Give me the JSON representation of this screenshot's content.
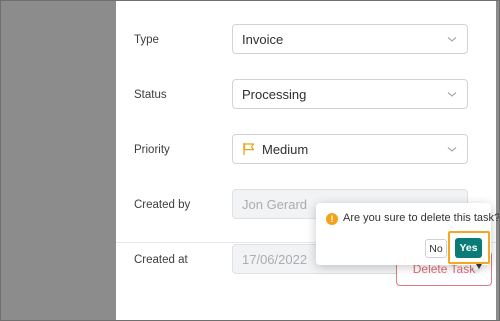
{
  "form": {
    "type": {
      "label": "Type",
      "value": "Invoice"
    },
    "status": {
      "label": "Status",
      "value": "Processing"
    },
    "priority": {
      "label": "Priority",
      "value": "Medium"
    },
    "created_by": {
      "label": "Created by",
      "value": "Jon Gerard"
    },
    "created_at": {
      "label": "Created at",
      "value": "17/06/2022"
    }
  },
  "footer": {
    "delete_label": "Delete Task"
  },
  "confirm": {
    "message": "Are you sure to delete this task?",
    "no_label": "No",
    "yes_label": "Yes",
    "icon_symbol": "!"
  },
  "colors": {
    "accent_teal": "#0a7c75",
    "danger": "#e06b75",
    "warning": "#f0a31b",
    "highlight": "#f5a623",
    "priority_flag": "#e8a317"
  },
  "icons": {
    "select_arrow": "chevron-down-icon",
    "priority": "flag-icon",
    "warning": "exclamation-circle-icon"
  }
}
